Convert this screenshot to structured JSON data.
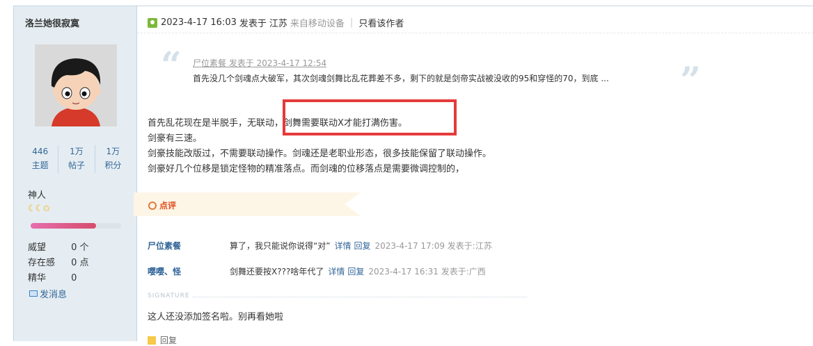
{
  "author": {
    "name": "洛兰她很寂寞",
    "stats": [
      {
        "num": "446",
        "label": "主题"
      },
      {
        "num": "1万",
        "label": "帖子"
      },
      {
        "num": "1万",
        "label": "积分"
      }
    ],
    "rank": "神人",
    "rank_icons": "☾☾✩",
    "progress": 0.72,
    "fields": [
      {
        "key": "威望",
        "value": "0 个"
      },
      {
        "key": "存在感",
        "value": "0 点"
      },
      {
        "key": "精华",
        "value": "0"
      }
    ],
    "send_message": "发消息"
  },
  "post": {
    "datetime": "2023-4-17 16:03",
    "posted_in_prefix": "发表于",
    "location": "江苏",
    "device": "来自移动设备",
    "only_author": "只看该作者",
    "quote": {
      "author_line": "尸位素餐 发表于 2023-4-17 12:54",
      "text": "首先没几个剑魂点大破军，其次剑魂剑舞比乱花葬差不多，剩下的就是剑帝实战被没收的95和穿怪的70，到底 ..."
    },
    "lines": [
      "首先乱花现在是半脱手，无联动，剑舞需要联动X才能打满伤害。",
      "剑豪有三速。",
      "剑豪技能改版过，不需要联动操作。剑魂还是老职业形态，很多技能保留了联动操作。",
      "剑豪好几个位移是锁定怪物的精准落点。而剑魂的位移落点是需要微调控制的，"
    ]
  },
  "comments": {
    "label": "点评",
    "items": [
      {
        "user": "尸位素餐",
        "text": "算了，我只能说你说得“对”",
        "detail": "详情",
        "reply": "回复",
        "meta": "2023-4-17 17:09 发表于:江苏"
      },
      {
        "user": "嘤嘤、怪",
        "text": "剑舞还要按X???啥年代了",
        "detail": "详情",
        "reply": "回复",
        "meta": "2023-4-17 16:31 发表于:广西"
      }
    ]
  },
  "signature": {
    "label": "SIGNATURE",
    "text": "这人还没添加签名啦。别再看她啦"
  },
  "footer": {
    "partial": "回复"
  },
  "colors": {
    "sidebar_bg": "#e5edf2",
    "link": "#336699",
    "highlight_box": "#e53a3a",
    "comment_label": "#e04b1a"
  }
}
